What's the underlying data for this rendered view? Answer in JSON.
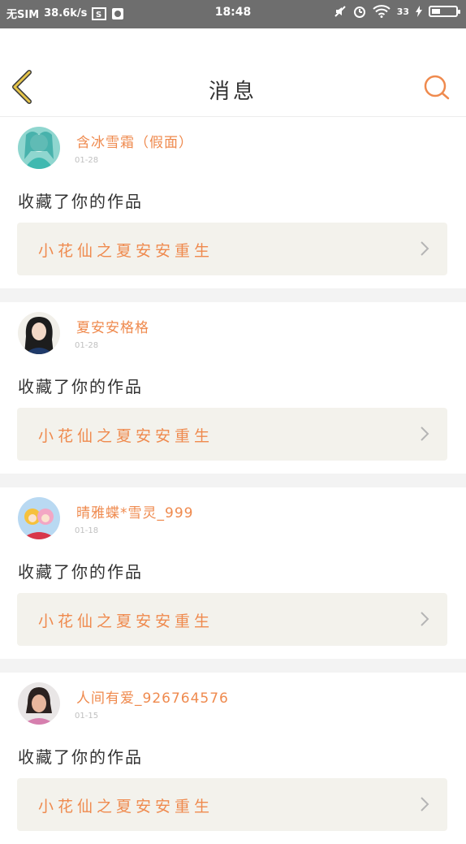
{
  "status_bar": {
    "sim": "无SIM",
    "speed": "38.6k/s",
    "time": "18:48",
    "battery": "33"
  },
  "header": {
    "title": "消息",
    "back_icon": "back-chevron-icon",
    "search_icon": "search-icon"
  },
  "colors": {
    "accent": "#ef8a4e",
    "back_yellow": "#e7c64b",
    "text": "#333333"
  },
  "notifications": [
    {
      "user": "含冰雪霜（假面）",
      "date": "01-28",
      "action": "收藏了你的作品",
      "work": "小花仙之夏安安重生"
    },
    {
      "user": "夏安安格格",
      "date": "01-28",
      "action": "收藏了你的作品",
      "work": "小花仙之夏安安重生"
    },
    {
      "user": "晴雅蝶*雪灵_999",
      "date": "01-18",
      "action": "收藏了你的作品",
      "work": "小花仙之夏安安重生"
    },
    {
      "user": "人间有爱_926764576",
      "date": "01-15",
      "action": "收藏了你的作品",
      "work": "小花仙之夏安安重生"
    }
  ]
}
